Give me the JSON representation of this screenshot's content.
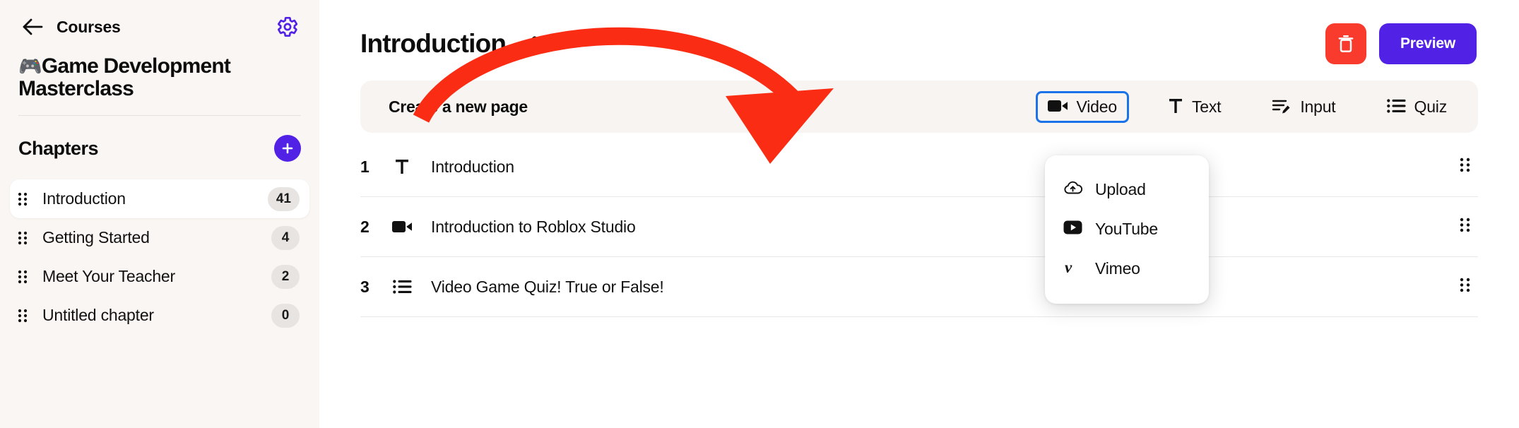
{
  "sidebar": {
    "back_label": "Courses",
    "back_icon": "arrow-left-icon",
    "settings_icon": "gear-icon",
    "course_emoji": "🎮",
    "course_title": "Game Development Masterclass",
    "chapters_heading": "Chapters",
    "add_chapter_icon": "plus-icon",
    "chapters": [
      {
        "label": "Introduction",
        "count": "41",
        "active": true
      },
      {
        "label": "Getting Started",
        "count": "4",
        "active": false
      },
      {
        "label": "Meet Your Teacher",
        "count": "2",
        "active": false
      },
      {
        "label": "Untitled chapter",
        "count": "0",
        "active": false
      }
    ]
  },
  "header": {
    "title": "Introduction",
    "edit_icon": "pencil-icon",
    "delete_icon": "trash-icon",
    "preview_label": "Preview"
  },
  "toolbar": {
    "create_label": "Create a new page",
    "buttons": [
      {
        "label": "Video",
        "icon": "video-camera-icon",
        "focused": true
      },
      {
        "label": "Text",
        "icon": "text-t-icon",
        "focused": false
      },
      {
        "label": "Input",
        "icon": "input-pencil-icon",
        "focused": false
      },
      {
        "label": "Quiz",
        "icon": "bullet-list-icon",
        "focused": false
      }
    ]
  },
  "video_menu": {
    "items": [
      {
        "label": "Upload",
        "icon": "cloud-upload-icon"
      },
      {
        "label": "YouTube",
        "icon": "youtube-icon"
      },
      {
        "label": "Vimeo",
        "icon": "vimeo-icon"
      }
    ]
  },
  "pages": [
    {
      "num": "1",
      "name": "Introduction",
      "icon": "text-t-icon",
      "handle": "drag-handle-icon"
    },
    {
      "num": "2",
      "name": "Introduction to Roblox Studio",
      "icon": "video-camera-icon",
      "handle": "drag-handle-icon"
    },
    {
      "num": "3",
      "name": "Video Game Quiz! True or False!",
      "icon": "bullet-list-icon",
      "handle": "drag-handle-icon"
    }
  ],
  "annotation": {
    "arrow_color": "#fa2d14",
    "description": "curved arrow pointing to Video button"
  },
  "colors": {
    "accent_purple": "#5221e6",
    "danger_red": "#f93b2d",
    "sidebar_bg": "#faf6f3",
    "toolbar_bg": "#f8f4f1",
    "focus_blue": "#1a73e8",
    "badge_bg": "#e7e4e1"
  }
}
